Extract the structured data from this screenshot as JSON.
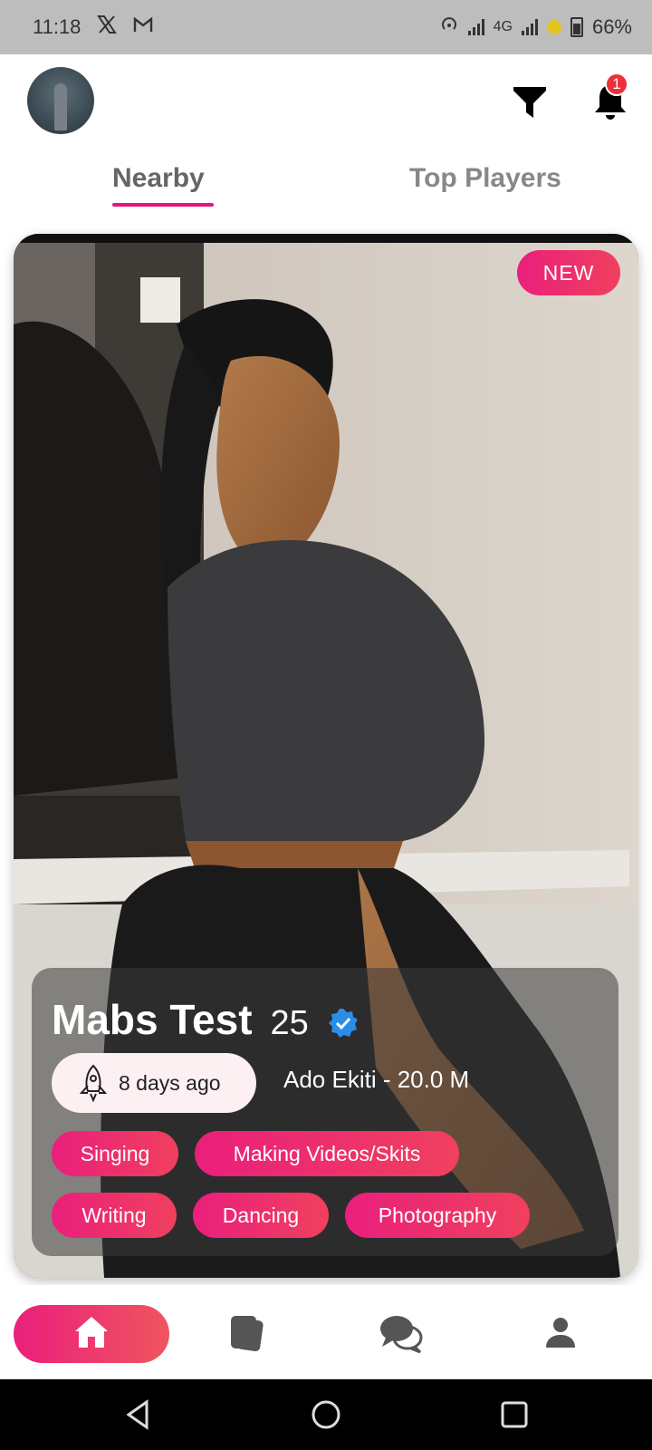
{
  "status_bar": {
    "time": "11:18",
    "network": "4G",
    "battery": "66%",
    "icons": [
      "x-icon",
      "gmail-icon",
      "hotspot-icon",
      "signal-icon",
      "signal-icon",
      "battery-saver-icon",
      "battery-icon"
    ]
  },
  "header": {
    "notification_count": "1",
    "icons": [
      "avatar",
      "filter-icon",
      "bell-icon"
    ]
  },
  "tabs": [
    {
      "label": "Nearby",
      "active": true
    },
    {
      "label": "Top Players",
      "active": false
    }
  ],
  "profile_card": {
    "badge": "NEW",
    "name": "Mabs Test",
    "age": "25",
    "verified": true,
    "last_active": "8 days ago",
    "location": "Ado Ekiti - 20.0 M",
    "interests": [
      "Singing",
      "Making Videos/Skits",
      "Writing",
      "Dancing",
      "Photography"
    ]
  },
  "bottom_nav": {
    "items": [
      "home-icon",
      "cards-icon",
      "chat-icon",
      "profile-icon"
    ],
    "active": "home-icon"
  },
  "colors": {
    "accent": "#e6157f",
    "accent_end": "#f0405e",
    "verified": "#2a8ee8",
    "notification": "#ee2e3a"
  }
}
